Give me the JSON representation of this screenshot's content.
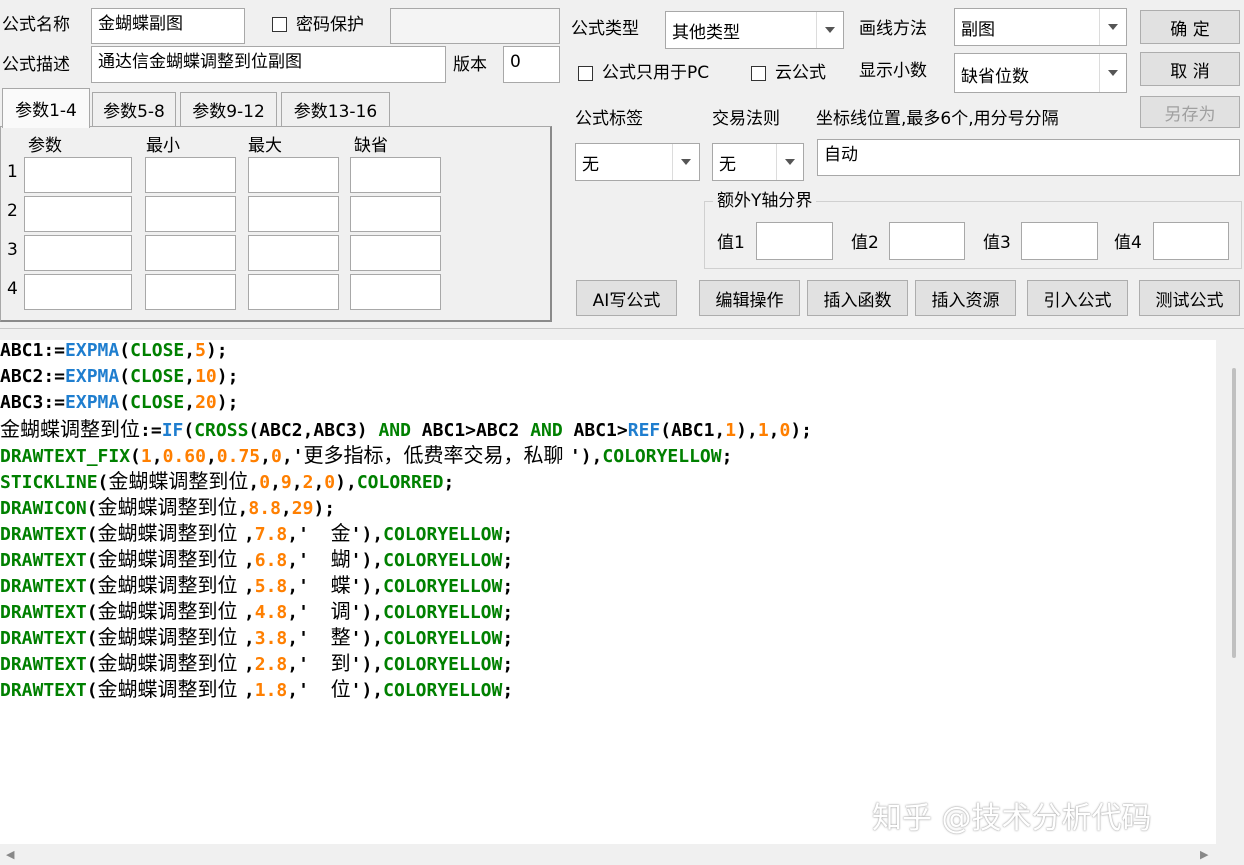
{
  "form": {
    "name_label": "公式名称",
    "name_value": "金蝴蝶副图",
    "password_label": "密码保护",
    "desc_label": "公式描述",
    "desc_value": "通达信金蝴蝶调整到位副图",
    "version_label": "版本",
    "version_value": "0",
    "type_label": "公式类型",
    "type_value": "其他类型",
    "draw_label": "画线方法",
    "draw_value": "副图",
    "pc_only_label": "公式只用于PC",
    "cloud_label": "云公式",
    "decimals_label": "显示小数",
    "decimals_value": "缺省位数",
    "tag_label": "公式标签",
    "tag_value": "无",
    "rule_label": "交易法则",
    "rule_value": "无",
    "axis_label": "坐标线位置,最多6个,用分号分隔",
    "axis_value": "自动",
    "extra_y_label": "额外Y轴分界",
    "val1": "值1",
    "val2": "值2",
    "val3": "值3",
    "val4": "值4"
  },
  "buttons": {
    "ok": "确  定",
    "cancel": "取  消",
    "save_as": "另存为",
    "ai": "AI写公式",
    "edit": "编辑操作",
    "insert_func": "插入函数",
    "insert_res": "插入资源",
    "import": "引入公式",
    "test": "测试公式"
  },
  "tabs": [
    "参数1-4",
    "参数5-8",
    "参数9-12",
    "参数13-16"
  ],
  "params": {
    "headers": [
      "参数",
      "最小",
      "最大",
      "缺省"
    ],
    "rows": [
      "1",
      "2",
      "3",
      "4"
    ]
  },
  "code_lines": [
    [
      [
        "k",
        "ABC1:="
      ],
      [
        "f",
        "EXPMA"
      ],
      [
        "k",
        "("
      ],
      [
        "g",
        "CLOSE"
      ],
      [
        "k",
        ","
      ],
      [
        "n",
        "5"
      ],
      [
        "k",
        ");"
      ]
    ],
    [
      [
        "k",
        "ABC2:="
      ],
      [
        "f",
        "EXPMA"
      ],
      [
        "k",
        "("
      ],
      [
        "g",
        "CLOSE"
      ],
      [
        "k",
        ","
      ],
      [
        "n",
        "10"
      ],
      [
        "k",
        ");"
      ]
    ],
    [
      [
        "k",
        "ABC3:="
      ],
      [
        "f",
        "EXPMA"
      ],
      [
        "k",
        "("
      ],
      [
        "g",
        "CLOSE"
      ],
      [
        "k",
        ","
      ],
      [
        "n",
        "20"
      ],
      [
        "k",
        ");"
      ]
    ],
    [
      [
        "s",
        "金蝴蝶调整到位"
      ],
      [
        "k",
        ":="
      ],
      [
        "f",
        "IF"
      ],
      [
        "k",
        "("
      ],
      [
        "g",
        "CROSS"
      ],
      [
        "k",
        "(ABC2,ABC3) "
      ],
      [
        "g",
        "AND"
      ],
      [
        "k",
        " ABC1>ABC2 "
      ],
      [
        "g",
        "AND"
      ],
      [
        "k",
        " ABC1>"
      ],
      [
        "f",
        "REF"
      ],
      [
        "k",
        "(ABC1,"
      ],
      [
        "n",
        "1"
      ],
      [
        "k",
        "),"
      ],
      [
        "n",
        "1"
      ],
      [
        "k",
        ","
      ],
      [
        "n",
        "0"
      ],
      [
        "k",
        ");"
      ]
    ],
    [
      [
        "g",
        "DRAWTEXT_FIX"
      ],
      [
        "k",
        "("
      ],
      [
        "n",
        "1"
      ],
      [
        "k",
        ","
      ],
      [
        "n",
        "0.60"
      ],
      [
        "k",
        ","
      ],
      [
        "n",
        "0.75"
      ],
      [
        "k",
        ","
      ],
      [
        "n",
        "0"
      ],
      [
        "k",
        ",'"
      ],
      [
        "s",
        "更多指标，低费率交易，私聊 "
      ],
      [
        "k",
        "'),"
      ],
      [
        "g",
        "COLORYELLOW"
      ],
      [
        "k",
        ";"
      ]
    ],
    [
      [
        "g",
        "STICKLINE"
      ],
      [
        "k",
        "("
      ],
      [
        "s",
        "金蝴蝶调整到位"
      ],
      [
        "k",
        ","
      ],
      [
        "n",
        "0"
      ],
      [
        "k",
        ","
      ],
      [
        "n",
        "9"
      ],
      [
        "k",
        ","
      ],
      [
        "n",
        "2"
      ],
      [
        "k",
        ","
      ],
      [
        "n",
        "0"
      ],
      [
        "k",
        "),"
      ],
      [
        "g",
        "COLORRED"
      ],
      [
        "k",
        ";"
      ]
    ],
    [
      [
        "g",
        "DRAWICON"
      ],
      [
        "k",
        "("
      ],
      [
        "s",
        "金蝴蝶调整到位"
      ],
      [
        "k",
        ","
      ],
      [
        "n",
        "8.8"
      ],
      [
        "k",
        ","
      ],
      [
        "n",
        "29"
      ],
      [
        "k",
        ");"
      ]
    ],
    [
      [
        "g",
        "DRAWTEXT"
      ],
      [
        "k",
        "("
      ],
      [
        "s",
        "金蝴蝶调整到位 "
      ],
      [
        "k",
        ","
      ],
      [
        "n",
        "7.8"
      ],
      [
        "k",
        ",'  "
      ],
      [
        "s",
        "金"
      ],
      [
        "k",
        "'),"
      ],
      [
        "g",
        "COLORYELLOW"
      ],
      [
        "k",
        ";"
      ]
    ],
    [
      [
        "g",
        "DRAWTEXT"
      ],
      [
        "k",
        "("
      ],
      [
        "s",
        "金蝴蝶调整到位 "
      ],
      [
        "k",
        ","
      ],
      [
        "n",
        "6.8"
      ],
      [
        "k",
        ",'  "
      ],
      [
        "s",
        "蝴"
      ],
      [
        "k",
        "'),"
      ],
      [
        "g",
        "COLORYELLOW"
      ],
      [
        "k",
        ";"
      ]
    ],
    [
      [
        "g",
        "DRAWTEXT"
      ],
      [
        "k",
        "("
      ],
      [
        "s",
        "金蝴蝶调整到位 "
      ],
      [
        "k",
        ","
      ],
      [
        "n",
        "5.8"
      ],
      [
        "k",
        ",'  "
      ],
      [
        "s",
        "蝶"
      ],
      [
        "k",
        "'),"
      ],
      [
        "g",
        "COLORYELLOW"
      ],
      [
        "k",
        ";"
      ]
    ],
    [
      [
        "g",
        "DRAWTEXT"
      ],
      [
        "k",
        "("
      ],
      [
        "s",
        "金蝴蝶调整到位 "
      ],
      [
        "k",
        ","
      ],
      [
        "n",
        "4.8"
      ],
      [
        "k",
        ",'  "
      ],
      [
        "s",
        "调"
      ],
      [
        "k",
        "'),"
      ],
      [
        "g",
        "COLORYELLOW"
      ],
      [
        "k",
        ";"
      ]
    ],
    [
      [
        "g",
        "DRAWTEXT"
      ],
      [
        "k",
        "("
      ],
      [
        "s",
        "金蝴蝶调整到位 "
      ],
      [
        "k",
        ","
      ],
      [
        "n",
        "3.8"
      ],
      [
        "k",
        ",'  "
      ],
      [
        "s",
        "整"
      ],
      [
        "k",
        "'),"
      ],
      [
        "g",
        "COLORYELLOW"
      ],
      [
        "k",
        ";"
      ]
    ],
    [
      [
        "g",
        "DRAWTEXT"
      ],
      [
        "k",
        "("
      ],
      [
        "s",
        "金蝴蝶调整到位 "
      ],
      [
        "k",
        ","
      ],
      [
        "n",
        "2.8"
      ],
      [
        "k",
        ",'  "
      ],
      [
        "s",
        "到"
      ],
      [
        "k",
        "'),"
      ],
      [
        "g",
        "COLORYELLOW"
      ],
      [
        "k",
        ";"
      ]
    ],
    [
      [
        "g",
        "DRAWTEXT"
      ],
      [
        "k",
        "("
      ],
      [
        "s",
        "金蝴蝶调整到位 "
      ],
      [
        "k",
        ","
      ],
      [
        "n",
        "1.8"
      ],
      [
        "k",
        ",'  "
      ],
      [
        "s",
        "位"
      ],
      [
        "k",
        "'),"
      ],
      [
        "g",
        "COLORYELLOW"
      ],
      [
        "k",
        ";"
      ]
    ]
  ],
  "watermark": "知乎 @技术分析代码",
  "colors": {
    "keyword_blue": "#1f7ecf",
    "keyword_green": "#008000",
    "number_orange": "#ff7f00"
  }
}
